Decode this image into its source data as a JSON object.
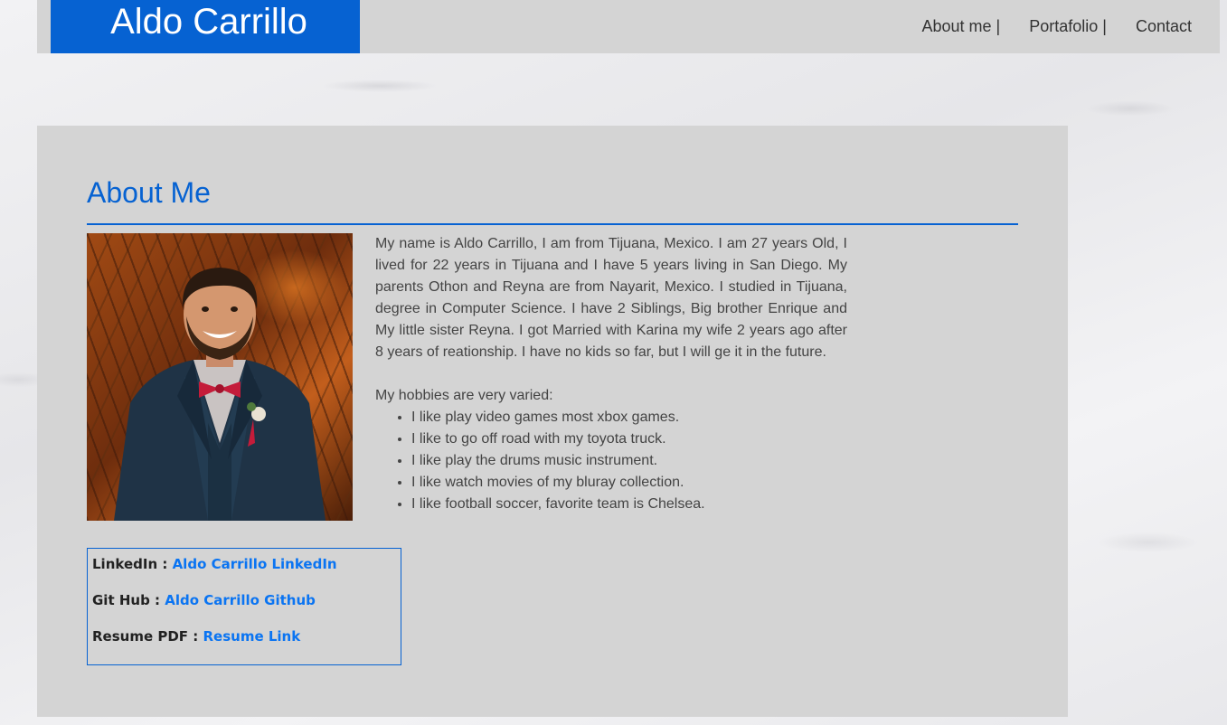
{
  "header": {
    "logo_text": "Aldo Carrillo",
    "nav": [
      "About me |",
      "Portafolio |",
      "Contact"
    ]
  },
  "about": {
    "title": "About Me",
    "paragraph": "My name is Aldo Carrillo, I am from Tijuana, Mexico. I am 27 years Old, I lived for 22 years in Tijuana and I have 5 years living in San Diego. My parents Othon and Reyna are from Nayarit, Mexico. I studied in Tijuana, degree in Computer Science. I have 2 Siblings, Big brother Enrique and My little sister Reyna. I got Married with Karina my wife 2 years ago after 8 years of reationship. I have no kids so far, but I will ge it in the future.",
    "hobbies_intro": "My hobbies are very varied:",
    "hobbies": [
      "I like play video games most xbox games.",
      "I like to go off road with my toyota truck.",
      "I like play the drums music instrument.",
      "I like watch movies of my bluray collection.",
      "I like football soccer, favorite team is Chelsea."
    ]
  },
  "links": [
    {
      "label": "LinkedIn :",
      "link": "Aldo Carrillo LinkedIn"
    },
    {
      "label": "Git Hub :",
      "link": "Aldo Carrillo Github"
    },
    {
      "label": "Resume PDF :",
      "link": "Resume Link"
    }
  ],
  "colors": {
    "accent": "#0662d2",
    "link": "#0a74f2",
    "panel": "#d4d4d4"
  }
}
